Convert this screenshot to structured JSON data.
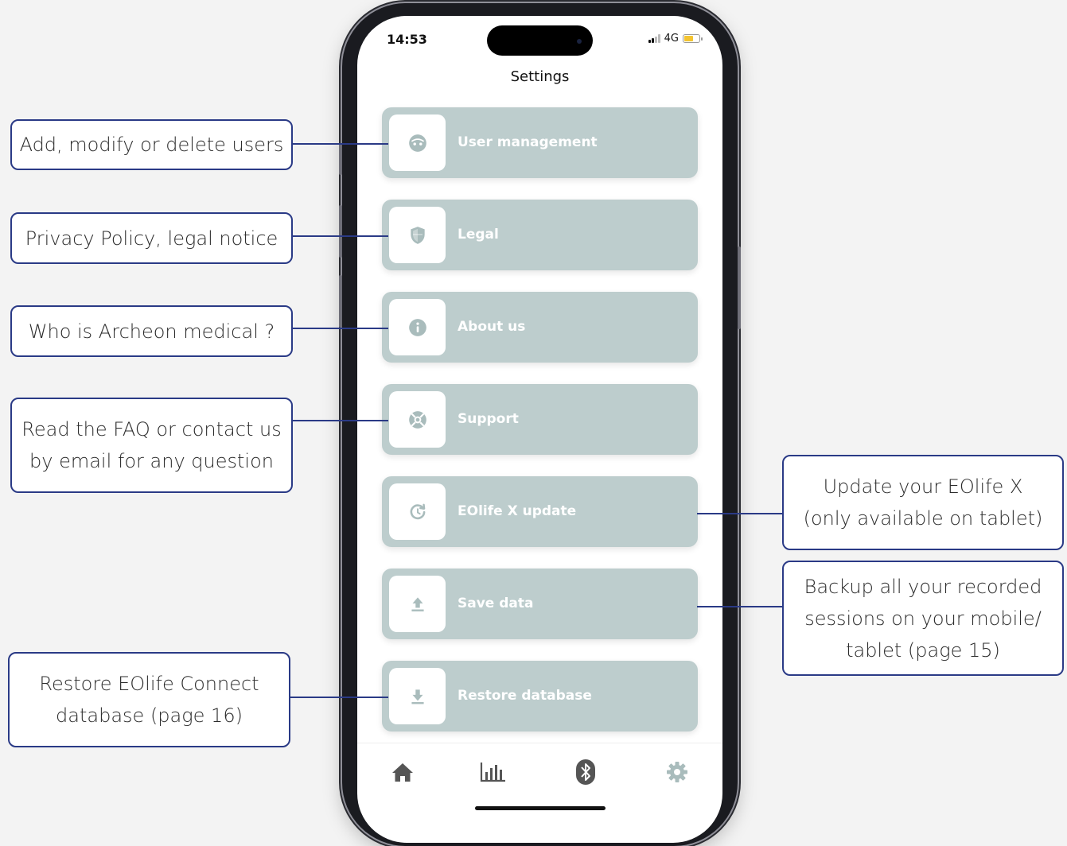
{
  "status_bar": {
    "time": "14:53",
    "network": "4G"
  },
  "screen_title": "Settings",
  "menu": [
    {
      "label": "User management",
      "icon": "face-icon"
    },
    {
      "label": "Legal",
      "icon": "shield-icon"
    },
    {
      "label": "About us",
      "icon": "info-icon"
    },
    {
      "label": "Support",
      "icon": "lifebuoy-icon"
    },
    {
      "label": "EOlife X update",
      "icon": "refresh-icon"
    },
    {
      "label": "Save data",
      "icon": "upload-icon"
    },
    {
      "label": "Restore database",
      "icon": "download-icon"
    }
  ],
  "tabs": [
    {
      "name": "home",
      "icon": "home-icon"
    },
    {
      "name": "statistics",
      "icon": "bar-chart-icon"
    },
    {
      "name": "bluetooth",
      "icon": "bluetooth-icon"
    },
    {
      "name": "settings",
      "icon": "gear-icon"
    }
  ],
  "callouts": {
    "user_management": "Add, modify or delete users",
    "legal": "Privacy Policy, legal notice",
    "about": "Who is Archeon medical ?",
    "support_line1": "Read the FAQ or contact us",
    "support_line2": "by email for any question",
    "update_line1": "Update your EOlife X",
    "update_line2": "(only available on tablet)",
    "save_line1": "Backup all your recorded",
    "save_line2": "sessions on your mobile/",
    "save_line3": "tablet (page 15)",
    "restore_line1": "Restore EOlife Connect",
    "restore_line2": "database  (page 16)"
  },
  "colors": {
    "menu_background": "#bdcdcd",
    "menu_text": "#ffffff",
    "icon_color": "#a9bcbc",
    "callout_border": "#2a3a86",
    "battery": "#f4c430"
  }
}
